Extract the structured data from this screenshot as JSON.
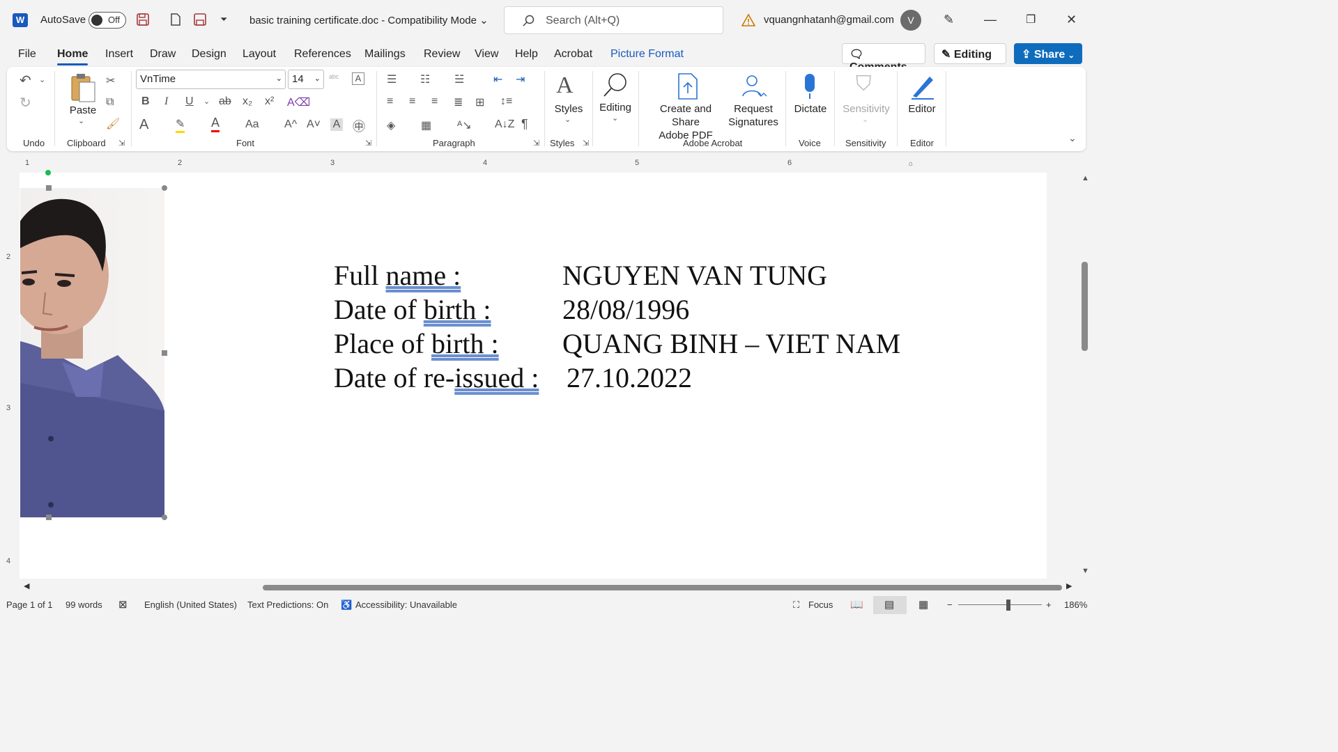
{
  "titlebar": {
    "app_logo": "W",
    "autosave_label": "AutoSave",
    "autosave_state": "Off",
    "doc_title": "basic training certificate.doc  -  Compatibility Mode",
    "search_placeholder": "Search (Alt+Q)",
    "account_email": "vquangnhatanh@gmail.com",
    "avatar_initial": "V"
  },
  "tabs": [
    "File",
    "Home",
    "Insert",
    "Draw",
    "Design",
    "Layout",
    "References",
    "Mailings",
    "Review",
    "View",
    "Help",
    "Acrobat",
    "Picture Format"
  ],
  "right_buttons": {
    "comments": "Comments",
    "editing": "Editing",
    "share": "Share"
  },
  "ribbon": {
    "groups": {
      "undo": "Undo",
      "clipboard": "Clipboard",
      "font": "Font",
      "paragraph": "Paragraph",
      "styles": "Styles",
      "adobe": "Adobe Acrobat",
      "voice": "Voice",
      "sensitivity": "Sensitivity",
      "editor": "Editor"
    },
    "font_name": "VnTime",
    "font_size": "14",
    "paste": "Paste",
    "styles_btn": "Styles",
    "editing_btn": "Editing",
    "create_share": "Create and Share",
    "adobe_pdf": "Adobe PDF",
    "request": "Request",
    "signatures": "Signatures",
    "dictate": "Dictate",
    "sensitivity_btn": "Sensitivity",
    "editor_btn": "Editor"
  },
  "ruler_numbers": [
    "1",
    "2",
    "3",
    "4",
    "5",
    "6"
  ],
  "vruler_numbers": [
    "2",
    "3",
    "4"
  ],
  "document": {
    "rows": [
      {
        "label_pre": "Full ",
        "label_u": "name :",
        "value": "NGUYEN VAN TUNG"
      },
      {
        "label_pre": "Date of ",
        "label_u": "birth :",
        "value": "28/08/1996"
      },
      {
        "label_pre": "Place of ",
        "label_u": "birth :",
        "value": "QUANG BINH – VIET NAM"
      },
      {
        "label_pre": "Date of re-",
        "label_u": "issued :",
        "value": "27.10.2022"
      }
    ]
  },
  "status": {
    "page": "Page 1 of 1",
    "words": "99 words",
    "language": "English (United States)",
    "predictions": "Text Predictions: On",
    "accessibility": "Accessibility: Unavailable",
    "focus": "Focus",
    "zoom": "186%"
  }
}
